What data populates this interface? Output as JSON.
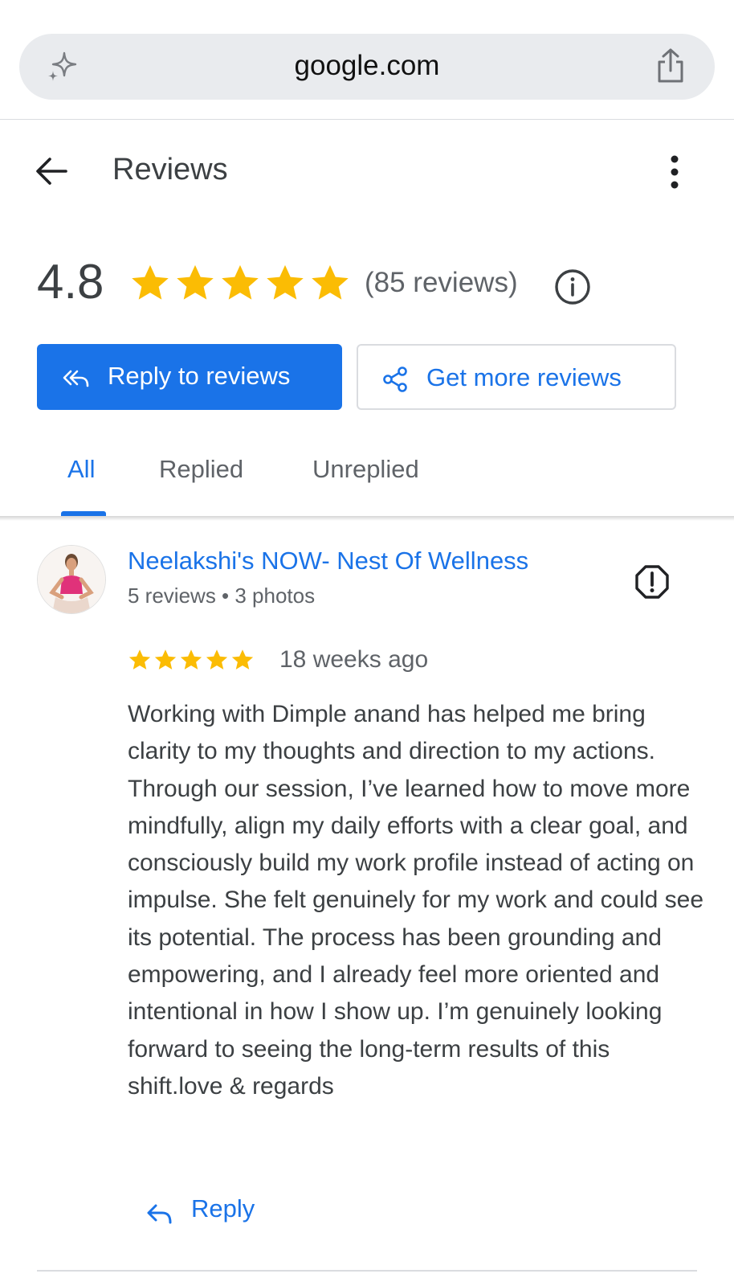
{
  "browser": {
    "url": "google.com"
  },
  "header": {
    "title": "Reviews"
  },
  "rating": {
    "average": "4.8",
    "stars": 5,
    "count_label": "(85 reviews)"
  },
  "actions": {
    "reply_label": "Reply to reviews",
    "get_more_label": "Get more reviews"
  },
  "tabs": [
    {
      "label": "All",
      "active": true
    },
    {
      "label": "Replied",
      "active": false
    },
    {
      "label": "Unreplied",
      "active": false
    }
  ],
  "review": {
    "name": "Neelakshi's NOW- Nest Of Wellness",
    "meta": "5 reviews • 3 photos",
    "stars": 5,
    "time": "18 weeks ago",
    "text": "Working with Dimple anand has helped me bring clarity to my thoughts and direction to my actions. Through our session, I’ve learned how to move more mindfully, align my daily efforts with a clear goal, and consciously build my work profile instead of acting on impulse. She felt genuinely for my work and could see its potential. The process has been grounding and empowering, and I already feel more oriented and intentional in how I show up. I’m genuinely looking forward to seeing the long-term results of this shift.love & regards",
    "reply_label": "Reply"
  },
  "colors": {
    "accent": "#1a73e8",
    "star": "#fbbc04",
    "text": "#3c4043",
    "muted": "#5f6368"
  },
  "icons": [
    "sparkle-icon",
    "share-icon",
    "back-arrow-icon",
    "more-vert-icon",
    "info-icon",
    "reply-all-icon",
    "share-nodes-icon",
    "flag-icon",
    "reply-icon",
    "star-icon"
  ]
}
